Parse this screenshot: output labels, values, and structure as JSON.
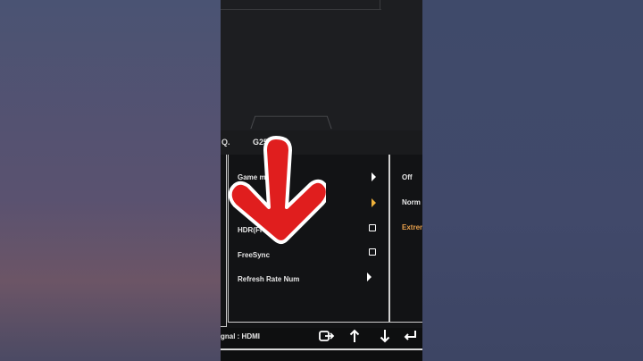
{
  "osd": {
    "header": {
      "logo_fragment": "Q.",
      "model": "G25-1"
    },
    "menu": [
      {
        "label": "Game mo",
        "control": "arrow"
      },
      {
        "label": "",
        "control": "arrow-selected"
      },
      {
        "label": "HDR(FI",
        "control": "checkbox"
      },
      {
        "label": "FreeSync",
        "control": "checkbox"
      },
      {
        "label": "Refresh Rate Num",
        "control": "arrow"
      }
    ],
    "values": [
      {
        "text": "Off",
        "active": false
      },
      {
        "text": "Norm",
        "active": false
      },
      {
        "text": "Extren",
        "active": true
      }
    ],
    "footer": {
      "signal": "gnal : HDMI",
      "buttons": [
        "input-icon",
        "up-arrow-icon",
        "down-arrow-icon",
        "enter-icon"
      ]
    }
  },
  "colors": {
    "accent_orange": "#e8a04c",
    "overlay_arrow_red": "#e01e1e",
    "osd_background": "#121315",
    "frame_line": "#cfcfcf"
  }
}
